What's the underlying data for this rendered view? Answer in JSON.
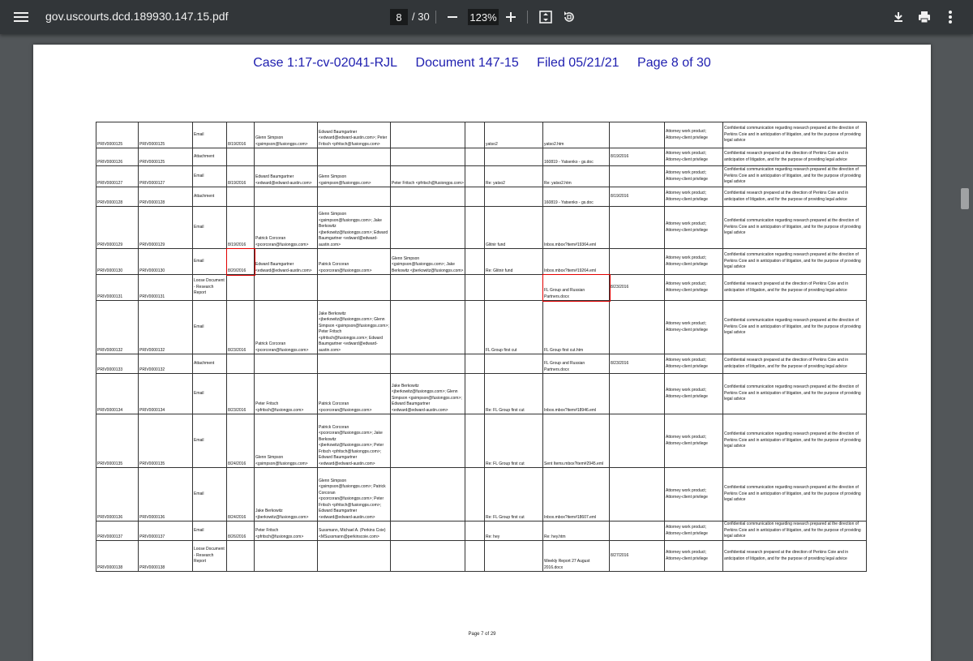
{
  "toolbar": {
    "title": "gov.uscourts.dcd.189930.147.15.pdf",
    "current_page": "8",
    "total_pages": "/ 30",
    "zoom": "123%"
  },
  "header": {
    "case": "Case 1:17-cv-02041-RJL",
    "document": "Document 147-15",
    "filed": "Filed 05/21/21",
    "page": "Page 8 of 30"
  },
  "footer": "Page 7 of 29",
  "rows": [
    {
      "id": "PRIV0000125",
      "parent": "PRIV0000125",
      "type": "Email",
      "date": "8/19/2016",
      "from": "Glenn Simpson <gsimpson@fusiongps.com>",
      "to": "Edward Baumgartner <edward@edward-austin.com>; Peter Fritsch <pfritsch@fusiongps.com>",
      "cc": "",
      "bcc": "",
      "subject": "yatso2",
      "filename": "yatso2.htm",
      "filedate": "",
      "priv": "Attorney work product; Attorney-client privilege",
      "desc": "Confidential communication regarding research prepared at the direction of Perkins Coie and in anticipation of litigation, and for the purpose of providing legal advice"
    },
    {
      "id": "PRIV0000126",
      "parent": "PRIV0000125",
      "type": "Attachment",
      "date": "",
      "from": "",
      "to": "",
      "cc": "",
      "bcc": "",
      "subject": "",
      "filename": "160819 - Yatsenko - gs.doc",
      "filedate": "8/19/2016",
      "priv": "Attorney work product; Attorney-client privilege",
      "desc": "Confidential research prepared at the direction of Perkins Coie and in anticipation of litigation, and for the purpose of providing legal advice"
    },
    {
      "id": "PRIV0000127",
      "parent": "PRIV0000127",
      "type": "Email",
      "date": "8/19/2016",
      "from": "Edward Baumgartner <edward@edward-austin.com>",
      "to": "Glenn Simpson <gsimpson@fusiongps.com>",
      "cc": "Peter Fritsch <pfritsch@fusiongps.com>",
      "bcc": "",
      "subject": "Re: yatso2",
      "filename": "Re: yatso2.htm",
      "filedate": "",
      "priv": "Attorney work product; Attorney-client privilege",
      "desc": "Confidential communication regarding research prepared at the direction of Perkins Coie and in anticipation of litigation, and for the purpose of providing legal advice"
    },
    {
      "id": "PRIV0000128",
      "parent": "PRIV0000128",
      "type": "Attachment",
      "date": "",
      "from": "",
      "to": "",
      "cc": "",
      "bcc": "",
      "subject": "",
      "filename": "160819 - Yatsenko - gs.doc",
      "filedate": "8/19/2016",
      "priv": "Attorney work product; Attorney-client privilege",
      "desc": "Confidential research prepared at the direction of Perkins Coie and in anticipation of litigation, and for the purpose of providing legal advice"
    },
    {
      "id": "PRIV0000129",
      "parent": "PRIV0000129",
      "type": "Email",
      "date": "8/19/2016",
      "from": "Patrick Corcoran <pcorcoran@fusiongps.com>",
      "to": "Glenn Simpson <gsimpson@fusiongps.com>; Jake Berkowitz <jberkowitz@fusiongps.com>; Edward Baumgartner <edward@edward-austin.com>",
      "cc": "",
      "bcc": "",
      "subject": "Glitnir fund",
      "filename": "Inbox.mbox?item#19364.eml",
      "filedate": "",
      "priv": "Attorney work product; Attorney-client privilege",
      "desc": "Confidential communication regarding research prepared at the direction of Perkins Coie and in anticipation of litigation, and for the purpose of providing legal advice"
    },
    {
      "id": "PRIV0000130",
      "parent": "PRIV0000130",
      "type": "Email",
      "date": "8/20/2016",
      "from": "Edward Baumgartner <edward@edward-austin.com>",
      "to": "Patrick Corcoran <pcorcoran@fusiongps.com>",
      "cc": "Glenn Simpson <gsimpson@fusiongps.com>; Jake Berkowitz <jberkowitz@fusiongps.com>",
      "bcc": "",
      "subject": "Re: Glitnir fund",
      "filename": "Inbox.mbox?item#19264.eml",
      "filedate": "",
      "priv": "Attorney work product; Attorney-client privilege",
      "desc": "Confidential communication regarding research prepared at the direction of Perkins Coie and in anticipation of litigation, and for the purpose of providing legal advice"
    },
    {
      "id": "PRIV0000131",
      "parent": "PRIV0000131",
      "type": "Loose Document - Research Report",
      "date": "",
      "from": "",
      "to": "",
      "cc": "",
      "bcc": "",
      "subject": "",
      "filename": "FL Group and Russian Partners.docx",
      "filedate": "8/23/2016",
      "priv": "Attorney work product; Attorney-client privilege",
      "desc": "Confidential research prepared at the direction of Perkins Coie and in anticipation of litigation, and for the purpose of providing legal advice"
    },
    {
      "id": "PRIV0000132",
      "parent": "PRIV0000132",
      "type": "Email",
      "date": "8/23/2016",
      "from": "Patrick Corcoran <pcorcoran@fusiongps.com>",
      "to": "Jake Berkowitz <jberkowitz@fusiongps.com>; Glenn Simpson <gsimpson@fusiongps.com>; Peter Fritsch <pfritsch@fusiongps.com>; Edward Baumgartner <edward@edward-austin.com>",
      "cc": "",
      "bcc": "",
      "subject": "FL Group first cut",
      "filename": "FL Group first cut.htm",
      "filedate": "",
      "priv": "Attorney work product; Attorney-client privilege",
      "desc": "Confidential communication regarding research prepared at the direction of Perkins Coie and in anticipation of litigation, and for the purpose of providing legal advice"
    },
    {
      "id": "PRIV0000133",
      "parent": "PRIV0000132",
      "type": "Attachment",
      "date": "",
      "from": "",
      "to": "",
      "cc": "",
      "bcc": "",
      "subject": "",
      "filename": "FL Group and Russian Partners.docx",
      "filedate": "8/23/2016",
      "priv": "Attorney work product; Attorney-client privilege",
      "desc": "Confidential research prepared at the direction of Perkins Coie and in anticipation of litigation, and for the purpose of providing legal advice"
    },
    {
      "id": "PRIV0000134",
      "parent": "PRIV0000134",
      "type": "Email",
      "date": "8/23/2016",
      "from": "Peter Fritsch <pfritsch@fusiongps.com>",
      "to": "Patrick Corcoran <pcorcoran@fusiongps.com>",
      "cc": "Jake Berkowitz <jberkowitz@fusiongps.com>; Glenn Simpson <gsimpson@fusiongps.com>; Edward Baumgartner <edward@edward-austin.com>",
      "bcc": "",
      "subject": "Re: FL Group first cut",
      "filename": "Inbox.mbox?item#18946.eml",
      "filedate": "",
      "priv": "Attorney work product; Attorney-client privilege",
      "desc": "Confidential communication regarding research prepared at the direction of Perkins Coie and in anticipation of litigation, and for the purpose of providing legal advice"
    },
    {
      "id": "PRIV0000135",
      "parent": "PRIV0000135",
      "type": "Email",
      "date": "8/24/2016",
      "from": "Glenn Simpson <gsimpson@fusiongps.com>",
      "to": "Patrick Corcoran <pcorcoran@fusiongps.com>; Jake Berkowitz <jberkowitz@fusiongps.com>; Peter Fritsch <pfritsch@fusiongps.com>; Edward Baumgartner <edward@edward-austin.com>",
      "cc": "",
      "bcc": "",
      "subject": "Re: FL Group first cut",
      "filename": "Sent Items.mbox?item#2945.eml",
      "filedate": "",
      "priv": "Attorney work product; Attorney-client privilege",
      "desc": "Confidential communication regarding research prepared at the direction of Perkins Coie and in anticipation of litigation, and for the purpose of providing legal advice"
    },
    {
      "id": "PRIV0000136",
      "parent": "PRIV0000136",
      "type": "Email",
      "date": "8/24/2016",
      "from": "Jake Berkowitz <jberkowitz@fusiongps.com>",
      "to": "Glenn Simpson <gsimpson@fusiongps.com>; Patrick Corcoran <pcorcoran@fusiongps.com>; Peter Fritsch <pfritsch@fusiongps.com>; Edward Baumgartner <edward@edward-austin.com>",
      "cc": "",
      "bcc": "",
      "subject": "Re: FL Group first cut",
      "filename": "Inbox.mbox?item#18607.eml",
      "filedate": "",
      "priv": "Attorney work product; Attorney-client privilege",
      "desc": "Confidential communication regarding research prepared at the direction of Perkins Coie and in anticipation of litigation, and for the purpose of providing legal advice"
    },
    {
      "id": "PRIV0000137",
      "parent": "PRIV0000137",
      "type": "Email",
      "date": "8/26/2016",
      "from": "Peter Fritsch <pfritsch@fusiongps.com>",
      "to": "Sussmann, Michael A. (Perkins Coie) <MSussmann@perkinscoie.com>",
      "cc": "",
      "bcc": "",
      "subject": "Re: hey",
      "filename": "Re: hey.htm",
      "filedate": "",
      "priv": "Attorney work product; Attorney-client privilege",
      "desc": "Confidential communication regarding research prepared at the direction of Perkins Coie and in anticipation of litigation, and for the purpose of providing legal advice"
    },
    {
      "id": "PRIV0000138",
      "parent": "PRIV0000138",
      "type": "Loose Document - Research Report",
      "date": "",
      "from": "",
      "to": "",
      "cc": "",
      "bcc": "",
      "subject": "",
      "filename": "Weekly Report 27 August 2016.docx",
      "filedate": "8/27/2016",
      "priv": "Attorney work product; Attorney-client privilege",
      "desc": "Confidential research prepared at the direction of Perkins Coie and in anticipation of litigation, and for the purpose of providing legal advice"
    }
  ]
}
